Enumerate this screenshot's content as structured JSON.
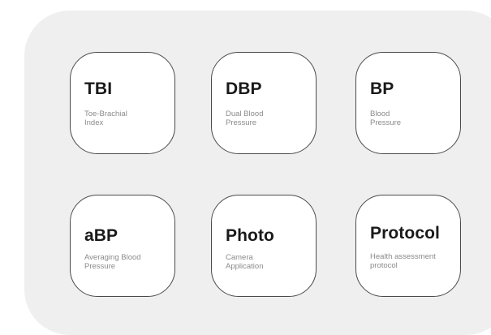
{
  "tiles": [
    {
      "name": "TBI",
      "desc": "Toe-Brachial Index"
    },
    {
      "name": "DBP",
      "desc": "Dual Blood Pressure"
    },
    {
      "name": "BP",
      "desc": "Blood Pressure"
    },
    {
      "name": "aBP",
      "desc": "Averaging Blood Pressure"
    },
    {
      "name": "Photo",
      "desc": "Camera Application"
    },
    {
      "name": "Protocol",
      "desc": "Health assessment protocol"
    }
  ]
}
